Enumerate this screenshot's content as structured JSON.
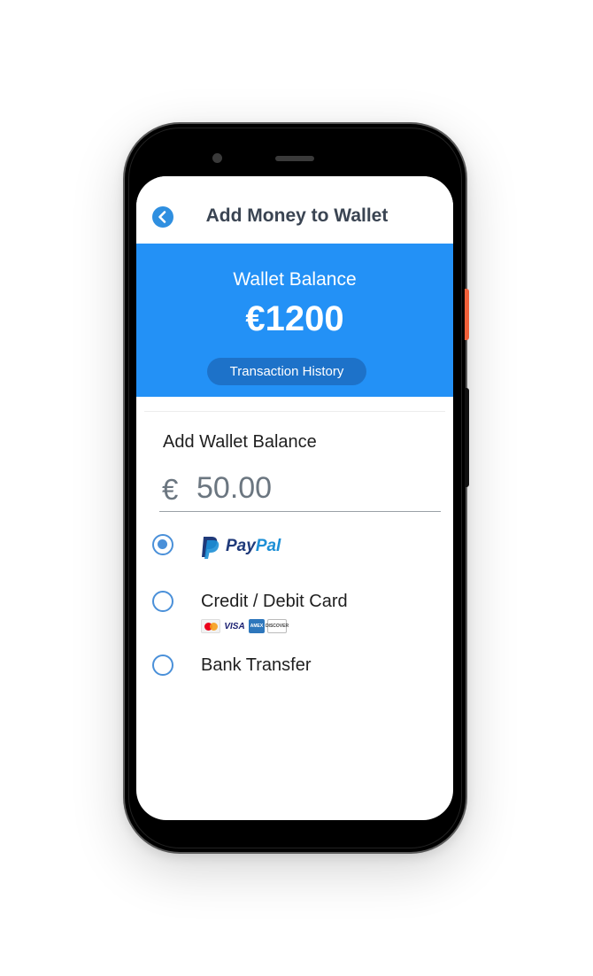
{
  "header": {
    "title": "Add Money to Wallet",
    "back_icon": "chevron-left-icon"
  },
  "wallet": {
    "label": "Wallet Balance",
    "amount": "€1200",
    "history_button": "Transaction History"
  },
  "add_balance": {
    "section_label": "Add Wallet Balance",
    "currency_symbol": "€",
    "amount_value": "50.00"
  },
  "payment_methods": {
    "selected": "paypal",
    "paypal": {
      "brand_part1": "Pay",
      "brand_part2": "Pal",
      "icon": "paypal-logo"
    },
    "card": {
      "label": "Credit / Debit Card",
      "logos": [
        "mastercard-logo",
        "visa-logo",
        "amex-logo",
        "discover-logo"
      ],
      "visa_text": "VISA",
      "amex_text": "AMEX",
      "discover_text": "DISCOVER"
    },
    "bank": {
      "label": "Bank Transfer"
    }
  },
  "colors": {
    "primary": "#2391f6",
    "button_dark": "#1d72c9",
    "radio": "#4a90d9",
    "title_text": "#3a4452"
  }
}
